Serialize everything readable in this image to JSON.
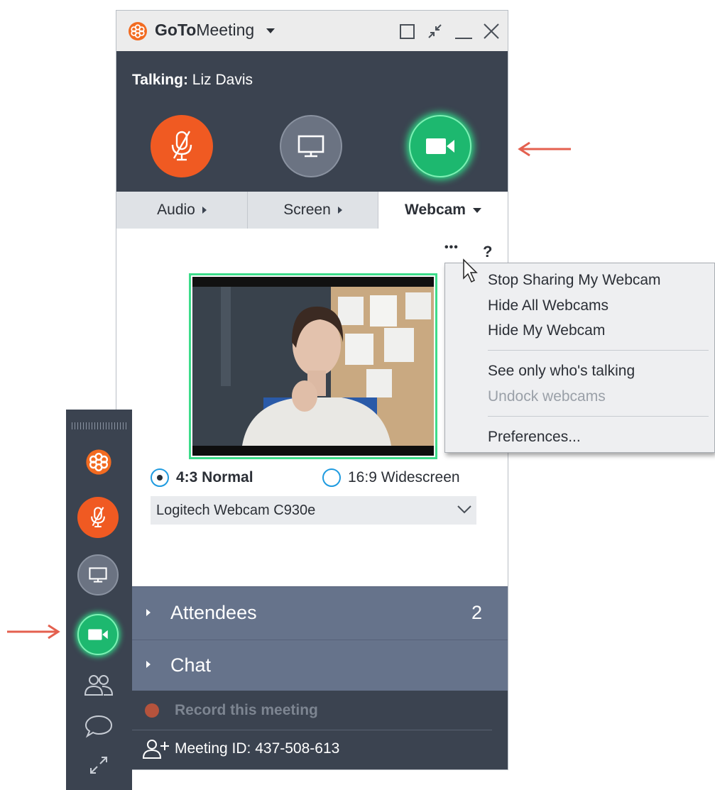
{
  "app": {
    "brand_bold": "GoTo",
    "brand_light": "Meeting"
  },
  "talking": {
    "label": "Talking:",
    "name": "Liz Davis"
  },
  "tabs": [
    {
      "label": "Audio"
    },
    {
      "label": "Screen"
    },
    {
      "label": "Webcam"
    }
  ],
  "webcam_panel": {
    "more_label": "•••",
    "help_label": "?",
    "aspect_options": [
      {
        "label": "4:3 Normal",
        "selected": true
      },
      {
        "label": "16:9 Widescreen",
        "selected": false
      }
    ],
    "camera_select": {
      "value": "Logitech Webcam C930e"
    }
  },
  "sections": {
    "attendees": {
      "label": "Attendees",
      "count": "2"
    },
    "chat": {
      "label": "Chat"
    },
    "record": {
      "label": "Record this meeting"
    },
    "meeting_id": {
      "label": "Meeting ID: 437-508-613"
    }
  },
  "menu": {
    "items": [
      {
        "label": "Stop Sharing My Webcam",
        "enabled": true
      },
      {
        "label": "Hide All Webcams",
        "enabled": true
      },
      {
        "label": "Hide My Webcam",
        "enabled": true
      },
      {
        "label": "See only who's talking",
        "enabled": true
      },
      {
        "label": "Undock webcams",
        "enabled": false
      },
      {
        "label": "Preferences...",
        "enabled": true
      }
    ]
  },
  "colors": {
    "mic_muted": "#f05a22",
    "screen": "#6b7382",
    "webcam_on": "#1db86f",
    "dark_panel": "#3b4350",
    "section_bg": "#66738b",
    "arrow": "#e4604f",
    "radio": "#1f9be0"
  }
}
